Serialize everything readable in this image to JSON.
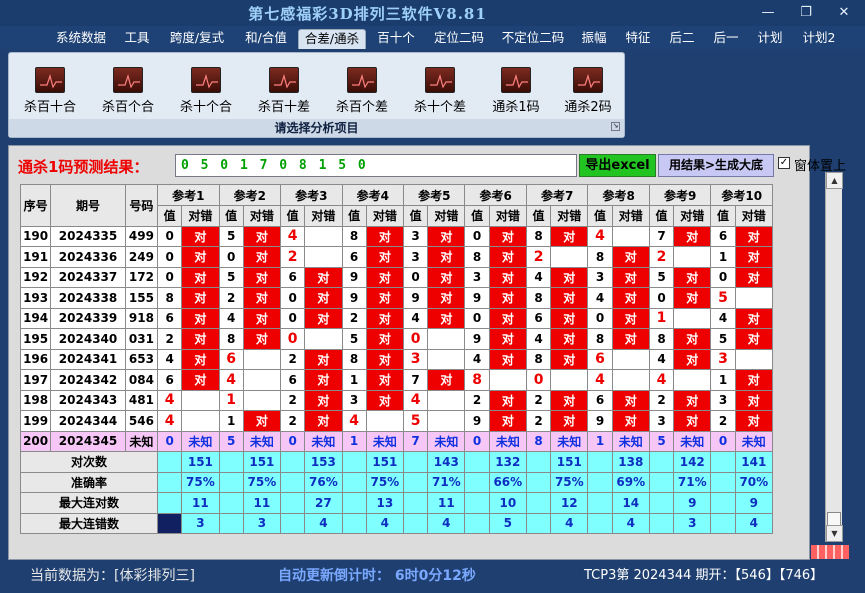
{
  "window": {
    "title": "第七感福彩3D排列三软件V8.81",
    "minimize": "—",
    "restore": "❐",
    "close": "✕"
  },
  "menu": [
    {
      "label": "系统数据",
      "active": false
    },
    {
      "label": "工具",
      "active": false
    },
    {
      "label": "跨度/复式",
      "active": false
    },
    {
      "label": "和/合值",
      "active": false
    },
    {
      "label": "合差/通杀",
      "active": true
    },
    {
      "label": "百十个",
      "active": false
    },
    {
      "label": "定位二码",
      "active": false
    },
    {
      "label": "不定位二码",
      "active": false
    },
    {
      "label": "振幅",
      "active": false
    },
    {
      "label": "特征",
      "active": false
    },
    {
      "label": "后二",
      "active": false
    },
    {
      "label": "后一",
      "active": false
    },
    {
      "label": "计划",
      "active": false
    },
    {
      "label": "计划2",
      "active": false
    }
  ],
  "ribbon": {
    "buttons": [
      "杀百十合",
      "杀百个合",
      "杀十个合",
      "杀百十差",
      "杀百个差",
      "杀十个差",
      "通杀1码",
      "通杀2码"
    ],
    "caption": "请选择分析项目"
  },
  "panel": {
    "result_label": "通杀1码预测结果：",
    "result_value": "0 5 0 1 7 0 8 1 5 0",
    "excel_button": "导出excel",
    "generate_button": "用结果>生成大底",
    "topmost_label": "窗体置上",
    "topmost_checked": "✓"
  },
  "table": {
    "headers": {
      "id": "序号",
      "period": "期号",
      "number": "号码",
      "val": "值",
      "dc": "对错"
    },
    "refs": [
      "参考1",
      "参考2",
      "参考3",
      "参考4",
      "参考5",
      "参考6",
      "参考7",
      "参考8",
      "参考9",
      "参考10"
    ],
    "rows": [
      {
        "id": "190",
        "period": "2024335",
        "num": "499",
        "cells": [
          [
            "0",
            "对"
          ],
          [
            "5",
            "对"
          ],
          [
            "4",
            ""
          ],
          [
            "8",
            "对"
          ],
          [
            "3",
            "对"
          ],
          [
            "0",
            "对"
          ],
          [
            "8",
            "对"
          ],
          [
            "4",
            ""
          ],
          [
            "7",
            "对"
          ],
          [
            "6",
            "对"
          ]
        ]
      },
      {
        "id": "191",
        "period": "2024336",
        "num": "249",
        "cells": [
          [
            "0",
            "对"
          ],
          [
            "0",
            "对"
          ],
          [
            "2",
            ""
          ],
          [
            "6",
            "对"
          ],
          [
            "3",
            "对"
          ],
          [
            "8",
            "对"
          ],
          [
            "2",
            ""
          ],
          [
            "8",
            "对"
          ],
          [
            "2",
            ""
          ],
          [
            "1",
            "对"
          ]
        ]
      },
      {
        "id": "192",
        "period": "2024337",
        "num": "172",
        "cells": [
          [
            "0",
            "对"
          ],
          [
            "5",
            "对"
          ],
          [
            "6",
            "对"
          ],
          [
            "9",
            "对"
          ],
          [
            "0",
            "对"
          ],
          [
            "3",
            "对"
          ],
          [
            "4",
            "对"
          ],
          [
            "3",
            "对"
          ],
          [
            "5",
            "对"
          ],
          [
            "0",
            "对"
          ]
        ]
      },
      {
        "id": "193",
        "period": "2024338",
        "num": "155",
        "cells": [
          [
            "8",
            "对"
          ],
          [
            "2",
            "对"
          ],
          [
            "0",
            "对"
          ],
          [
            "9",
            "对"
          ],
          [
            "9",
            "对"
          ],
          [
            "9",
            "对"
          ],
          [
            "8",
            "对"
          ],
          [
            "4",
            "对"
          ],
          [
            "0",
            "对"
          ],
          [
            "5",
            ""
          ]
        ]
      },
      {
        "id": "194",
        "period": "2024339",
        "num": "918",
        "cells": [
          [
            "6",
            "对"
          ],
          [
            "4",
            "对"
          ],
          [
            "0",
            "对"
          ],
          [
            "2",
            "对"
          ],
          [
            "4",
            "对"
          ],
          [
            "0",
            "对"
          ],
          [
            "6",
            "对"
          ],
          [
            "0",
            "对"
          ],
          [
            "1",
            ""
          ],
          [
            "4",
            "对"
          ]
        ]
      },
      {
        "id": "195",
        "period": "2024340",
        "num": "031",
        "cells": [
          [
            "2",
            "对"
          ],
          [
            "8",
            "对"
          ],
          [
            "0",
            ""
          ],
          [
            "5",
            "对"
          ],
          [
            "0",
            ""
          ],
          [
            "9",
            "对"
          ],
          [
            "4",
            "对"
          ],
          [
            "8",
            "对"
          ],
          [
            "8",
            "对"
          ],
          [
            "5",
            "对"
          ]
        ]
      },
      {
        "id": "196",
        "period": "2024341",
        "num": "653",
        "cells": [
          [
            "4",
            "对"
          ],
          [
            "6",
            ""
          ],
          [
            "2",
            "对"
          ],
          [
            "8",
            "对"
          ],
          [
            "3",
            ""
          ],
          [
            "4",
            "对"
          ],
          [
            "8",
            "对"
          ],
          [
            "6",
            ""
          ],
          [
            "4",
            "对"
          ],
          [
            "3",
            ""
          ]
        ]
      },
      {
        "id": "197",
        "period": "2024342",
        "num": "084",
        "cells": [
          [
            "6",
            "对"
          ],
          [
            "4",
            ""
          ],
          [
            "6",
            "对"
          ],
          [
            "1",
            "对"
          ],
          [
            "7",
            "对"
          ],
          [
            "8",
            ""
          ],
          [
            "0",
            ""
          ],
          [
            "4",
            ""
          ],
          [
            "4",
            ""
          ],
          [
            "1",
            "对"
          ]
        ]
      },
      {
        "id": "198",
        "period": "2024343",
        "num": "481",
        "cells": [
          [
            "4",
            ""
          ],
          [
            "1",
            ""
          ],
          [
            "2",
            "对"
          ],
          [
            "3",
            "对"
          ],
          [
            "4",
            ""
          ],
          [
            "2",
            "对"
          ],
          [
            "2",
            "对"
          ],
          [
            "6",
            "对"
          ],
          [
            "2",
            "对"
          ],
          [
            "3",
            "对"
          ]
        ]
      },
      {
        "id": "199",
        "period": "2024344",
        "num": "546",
        "cells": [
          [
            "4",
            ""
          ],
          [
            "1",
            "对"
          ],
          [
            "2",
            "对"
          ],
          [
            "4",
            ""
          ],
          [
            "5",
            ""
          ],
          [
            "9",
            "对"
          ],
          [
            "2",
            "对"
          ],
          [
            "9",
            "对"
          ],
          [
            "3",
            "对"
          ],
          [
            "2",
            "对"
          ]
        ]
      }
    ],
    "predict": {
      "id": "200",
      "period": "2024345",
      "num": "未知",
      "cells": [
        [
          "0",
          "未知"
        ],
        [
          "5",
          "未知"
        ],
        [
          "0",
          "未知"
        ],
        [
          "1",
          "未知"
        ],
        [
          "7",
          "未知"
        ],
        [
          "0",
          "未知"
        ],
        [
          "8",
          "未知"
        ],
        [
          "1",
          "未知"
        ],
        [
          "5",
          "未知"
        ],
        [
          "0",
          "未知"
        ]
      ]
    },
    "stats": [
      {
        "label": "对次数",
        "values": [
          "151",
          "151",
          "153",
          "151",
          "143",
          "132",
          "151",
          "138",
          "142",
          "141"
        ]
      },
      {
        "label": "准确率",
        "values": [
          "75%",
          "75%",
          "76%",
          "75%",
          "71%",
          "66%",
          "75%",
          "69%",
          "71%",
          "70%"
        ]
      },
      {
        "label": "最大连对数",
        "values": [
          "11",
          "11",
          "27",
          "13",
          "11",
          "10",
          "12",
          "14",
          "9",
          "9"
        ]
      },
      {
        "label": "最大连错数",
        "values": [
          "3",
          "3",
          "4",
          "4",
          "4",
          "5",
          "4",
          "4",
          "3",
          "4"
        ]
      }
    ]
  },
  "status": {
    "current_data": "当前数据为：[体彩排列三]",
    "countdown": "自动更新倒计时：  6时0分12秒",
    "latest": "TCP3第  2024344  期开：【546】【746】"
  },
  "colors": {
    "hit": "#ee0000",
    "predict_row": "#f6c7f6",
    "stat_row": "#7fffff",
    "predict_text": "#1030e0"
  }
}
